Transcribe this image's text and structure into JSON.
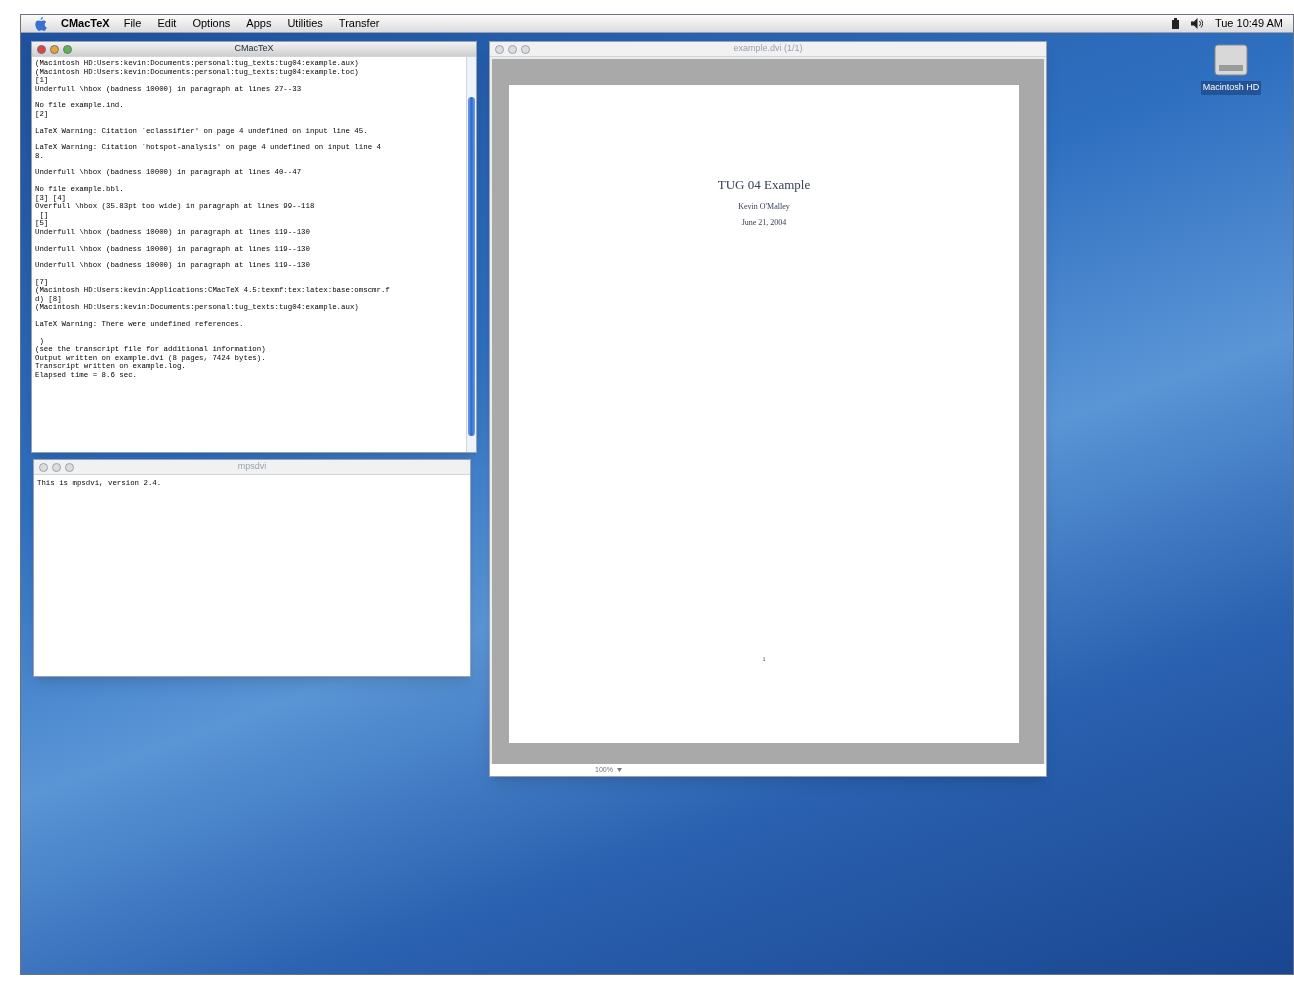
{
  "menu_bar": {
    "app_name": "CMacTeX",
    "menus": [
      "File",
      "Edit",
      "Options",
      "Apps",
      "Utilities",
      "Transfer"
    ],
    "clock": "Tue 10:49 AM"
  },
  "console_window": {
    "title": "CMacTeX",
    "active": true,
    "blocks": [
      [
        "(Macintosh HD:Users:kevin:Documents:personal:tug_texts:tug04:example.aux)",
        "(Macintosh HD:Users:kevin:Documents:personal:tug_texts:tug04:example.toc)",
        "[1]",
        "Underfull \\hbox (badness 10000) in paragraph at lines 27--33"
      ],
      [
        "No file example.ind.",
        "[2]"
      ],
      [
        "LaTeX Warning: Citation `eclassifier' on page 4 undefined on input line 45."
      ],
      [
        "LaTeX Warning: Citation `hotspot-analysis' on page 4 undefined on input line 4",
        "8."
      ],
      [
        "Underfull \\hbox (badness 10000) in paragraph at lines 40--47"
      ],
      [
        "No file example.bbl.",
        "[3] [4]",
        "Overfull \\hbox (35.83pt too wide) in paragraph at lines 99--118",
        " []",
        "[5]",
        "Underfull \\hbox (badness 10000) in paragraph at lines 119--130"
      ],
      [
        "Underfull \\hbox (badness 10000) in paragraph at lines 119--130"
      ],
      [
        "Underfull \\hbox (badness 10000) in paragraph at lines 119--130"
      ],
      [
        "[7]",
        "(Macintosh HD:Users:kevin:Applications:CMacTeX 4.5:texmf:tex:latex:base:omscmr.f",
        "d) [8]",
        "(Macintosh HD:Users:kevin:Documents:personal:tug_texts:tug04:example.aux)"
      ],
      [
        "LaTeX Warning: There were undefined references."
      ],
      [
        " )",
        "(see the transcript file for additional information)",
        "Output written on example.dvi (8 pages, 7424 bytes).",
        "Transcript written on example.log.",
        "Elapsed time = 8.6 sec."
      ]
    ]
  },
  "driver_window": {
    "title": "mpsdvi",
    "active": false,
    "lines": [
      "This is mpsdvi, version 2.4."
    ]
  },
  "viewer_window": {
    "title": "example.dvi (1/1)",
    "active": false,
    "page": {
      "title": "TUG 04 Example",
      "author": "Kevin O'Malley",
      "date": "June 21, 2004",
      "page_number": "1"
    },
    "zoom": "100%"
  },
  "desktop_icons": [
    {
      "label": "Macintosh HD"
    }
  ]
}
